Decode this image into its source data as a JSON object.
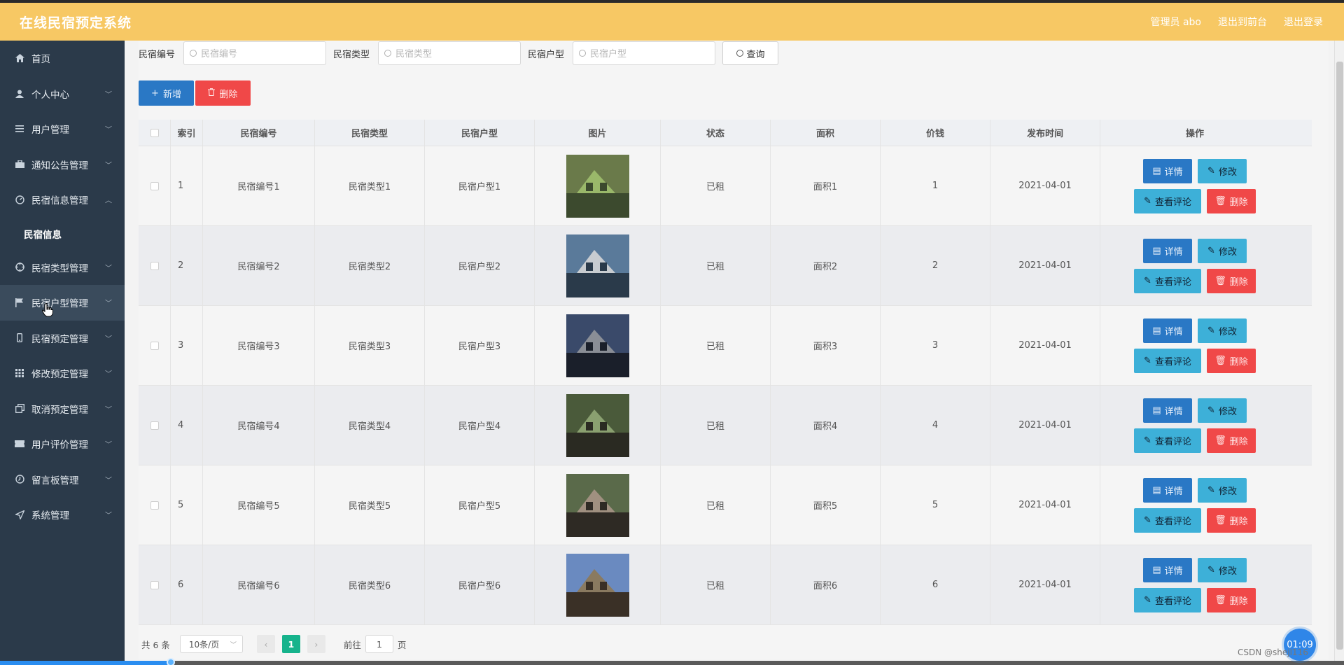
{
  "header": {
    "title": "在线民宿预定系统",
    "admin_label": "管理员 abo",
    "front_link": "退出到前台",
    "logout_link": "退出登录"
  },
  "sidebar": {
    "items": [
      {
        "label": "首页",
        "icon": "home-icon"
      },
      {
        "label": "个人中心",
        "icon": "user-icon"
      },
      {
        "label": "用户管理",
        "icon": "list-icon"
      },
      {
        "label": "通知公告管理",
        "icon": "briefcase-icon"
      },
      {
        "label": "民宿信息管理",
        "icon": "gauge-icon"
      },
      {
        "label": "民宿类型管理",
        "icon": "crosshair-icon"
      },
      {
        "label": "民宿户型管理",
        "icon": "flag-icon"
      },
      {
        "label": "民宿预定管理",
        "icon": "mobile-icon"
      },
      {
        "label": "修改预定管理",
        "icon": "grid-icon"
      },
      {
        "label": "取消预定管理",
        "icon": "copy-icon"
      },
      {
        "label": "用户评价管理",
        "icon": "ticket-icon"
      },
      {
        "label": "留言板管理",
        "icon": "clock-icon"
      },
      {
        "label": "系统管理",
        "icon": "send-icon"
      }
    ],
    "sub_item": "民宿信息"
  },
  "search": {
    "fields": [
      {
        "label": "民宿编号",
        "placeholder": "民宿编号"
      },
      {
        "label": "民宿类型",
        "placeholder": "民宿类型"
      },
      {
        "label": "民宿户型",
        "placeholder": "民宿户型"
      }
    ],
    "query_label": "查询"
  },
  "actions": {
    "add_label": "新增",
    "delete_label": "删除"
  },
  "table": {
    "headers": [
      "索引",
      "民宿编号",
      "民宿类型",
      "民宿户型",
      "图片",
      "状态",
      "面积",
      "价钱",
      "发布时间",
      "操作"
    ],
    "rows": [
      {
        "index": "1",
        "no": "民宿编号1",
        "type": "民宿类型1",
        "room": "民宿户型1",
        "status": "已租",
        "area": "面积1",
        "price": "1",
        "time": "2021-04-01",
        "img_colors": [
          "#6a7a4a",
          "#3c4a2e",
          "#9ab86a"
        ]
      },
      {
        "index": "2",
        "no": "民宿编号2",
        "type": "民宿类型2",
        "room": "民宿户型2",
        "status": "已租",
        "area": "面积2",
        "price": "2",
        "time": "2021-04-01",
        "img_colors": [
          "#5a7a9a",
          "#2a3a4a",
          "#c8ccd0"
        ]
      },
      {
        "index": "3",
        "no": "民宿编号3",
        "type": "民宿类型3",
        "room": "民宿户型3",
        "status": "已租",
        "area": "面积3",
        "price": "3",
        "time": "2021-04-01",
        "img_colors": [
          "#3a4a6a",
          "#1a1f2a",
          "#8a8e96"
        ]
      },
      {
        "index": "4",
        "no": "民宿编号4",
        "type": "民宿类型4",
        "room": "民宿户型4",
        "status": "已租",
        "area": "面积4",
        "price": "4",
        "time": "2021-04-01",
        "img_colors": [
          "#4a5a3a",
          "#2a2a22",
          "#8aa070"
        ]
      },
      {
        "index": "5",
        "no": "民宿编号5",
        "type": "民宿类型5",
        "room": "民宿户型5",
        "status": "已租",
        "area": "面积5",
        "price": "5",
        "time": "2021-04-01",
        "img_colors": [
          "#5a6a4a",
          "#2e2a24",
          "#a09080"
        ]
      },
      {
        "index": "6",
        "no": "民宿编号6",
        "type": "民宿类型6",
        "room": "民宿户型6",
        "status": "已租",
        "area": "面积6",
        "price": "6",
        "time": "2021-04-01",
        "img_colors": [
          "#6a8ac0",
          "#3a3026",
          "#8a7a60"
        ]
      }
    ],
    "op_labels": {
      "detail": "详情",
      "edit": "修改",
      "review": "查看评论",
      "delete": "删除"
    }
  },
  "pagination": {
    "total": "共 6 条",
    "page_size": "10条/页",
    "current_page": "1",
    "goto_label": "前往",
    "goto_value": "1",
    "page_suffix": "页"
  },
  "overlay": {
    "timer": "01:09",
    "watermark": "CSDN @shejl116"
  },
  "colors": {
    "header_bg": "#f7c864",
    "sidebar_bg": "#2b3a4a",
    "primary": "#2a78c5",
    "info": "#3db0d8",
    "danger": "#f04848",
    "pager_active": "#16b38c"
  }
}
